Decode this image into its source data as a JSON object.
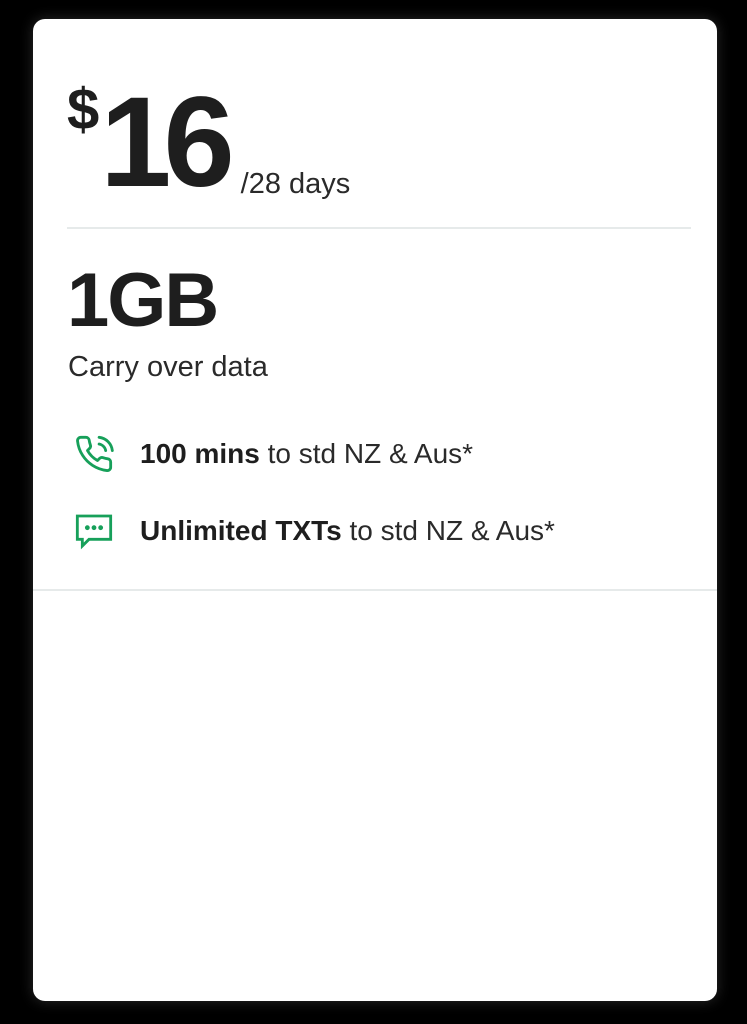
{
  "plan": {
    "currency": "$",
    "price": "16",
    "period": "/28 days",
    "data_amount": "1GB",
    "data_note": "Carry over data",
    "features": [
      {
        "icon": "phone-icon",
        "bold": "100 mins",
        "rest": " to std NZ & Aus*"
      },
      {
        "icon": "message-icon",
        "bold": "Unlimited TXTs",
        "rest": " to std NZ & Aus*"
      }
    ]
  },
  "colors": {
    "accent": "#17a05a",
    "text": "#1e1e1e",
    "divider": "#e6eaea",
    "card": "#ffffff"
  }
}
